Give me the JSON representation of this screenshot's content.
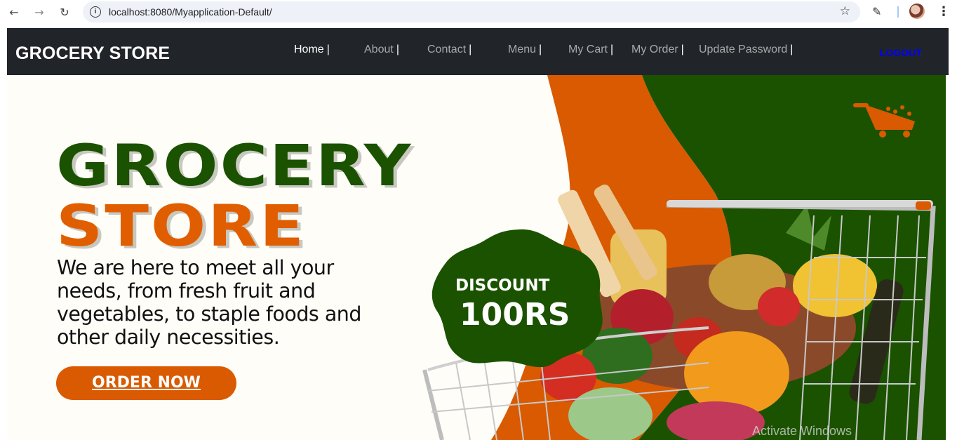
{
  "browser": {
    "url": "localhost:8080/Myapplication-Default/",
    "back_icon": "arrow-left-icon",
    "forward_icon": "arrow-right-icon",
    "reload_icon": "reload-icon",
    "info_icon": "i"
  },
  "navbar": {
    "brand": "GROCERY STORE",
    "links": [
      {
        "label": "Home",
        "sep": "|"
      },
      {
        "label": "About",
        "sep": "|"
      },
      {
        "label": "Contact",
        "sep": "|"
      },
      {
        "label": "Menu",
        "sep": "|"
      },
      {
        "label": "My Cart",
        "sep": "|"
      },
      {
        "label": "My Order",
        "sep": "|"
      },
      {
        "label": "Update Password",
        "sep": "|"
      }
    ],
    "logout": "LOGOUT"
  },
  "hero": {
    "title_line1": "GROCERY",
    "title_line2": "STORE",
    "tagline": "We are here to meet all your needs, from fresh fruit and vegetables, to staple foods and other daily necessities.",
    "cta": "ORDER NOW",
    "discount_label": "DISCOUNT",
    "discount_amount": "100RS"
  },
  "colors": {
    "green": "#1a5200",
    "orange": "#e05e00",
    "navbar": "#212529",
    "logout": "#0000ff"
  },
  "watermark": "Activate Windows"
}
